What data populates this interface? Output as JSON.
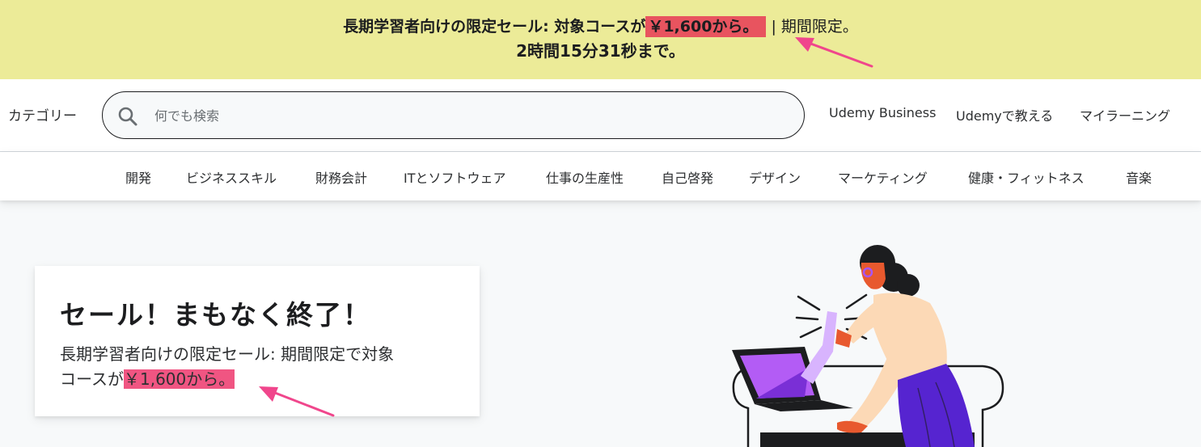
{
  "banner": {
    "headline": "長期学習者向けの限定セール: 対象コースが",
    "price_highlight": "￥1,600から。",
    "suffix": "| 期間限定。",
    "countdown": "2時間15分31秒まで。"
  },
  "header": {
    "categories_label": "カテゴリー",
    "search_placeholder": "何でも検索",
    "links": [
      "Udemy Business",
      "Udemyで教える",
      "マイラーニング"
    ]
  },
  "category_nav": [
    "開発",
    "ビジネススキル",
    "財務会計",
    "ITとソフトウェア",
    "仕事の生産性",
    "自己啓発",
    "デザイン",
    "マーケティング",
    "健康・フィットネス",
    "音楽"
  ],
  "hero": {
    "title": "セール！まもなく終了！",
    "body_line1": "長期学習者向けの限定セール: 期間限定で対象",
    "body_prefix": "コースが",
    "body_price": "￥1,600から。"
  },
  "colors": {
    "banner_bg": "#eceb98",
    "highlight_red": "#e8545f",
    "highlight_pink": "#f05582",
    "arrow_pink": "#f0468c",
    "illustration_purple": "#5624d0"
  },
  "icons": {
    "search": "search-icon"
  }
}
